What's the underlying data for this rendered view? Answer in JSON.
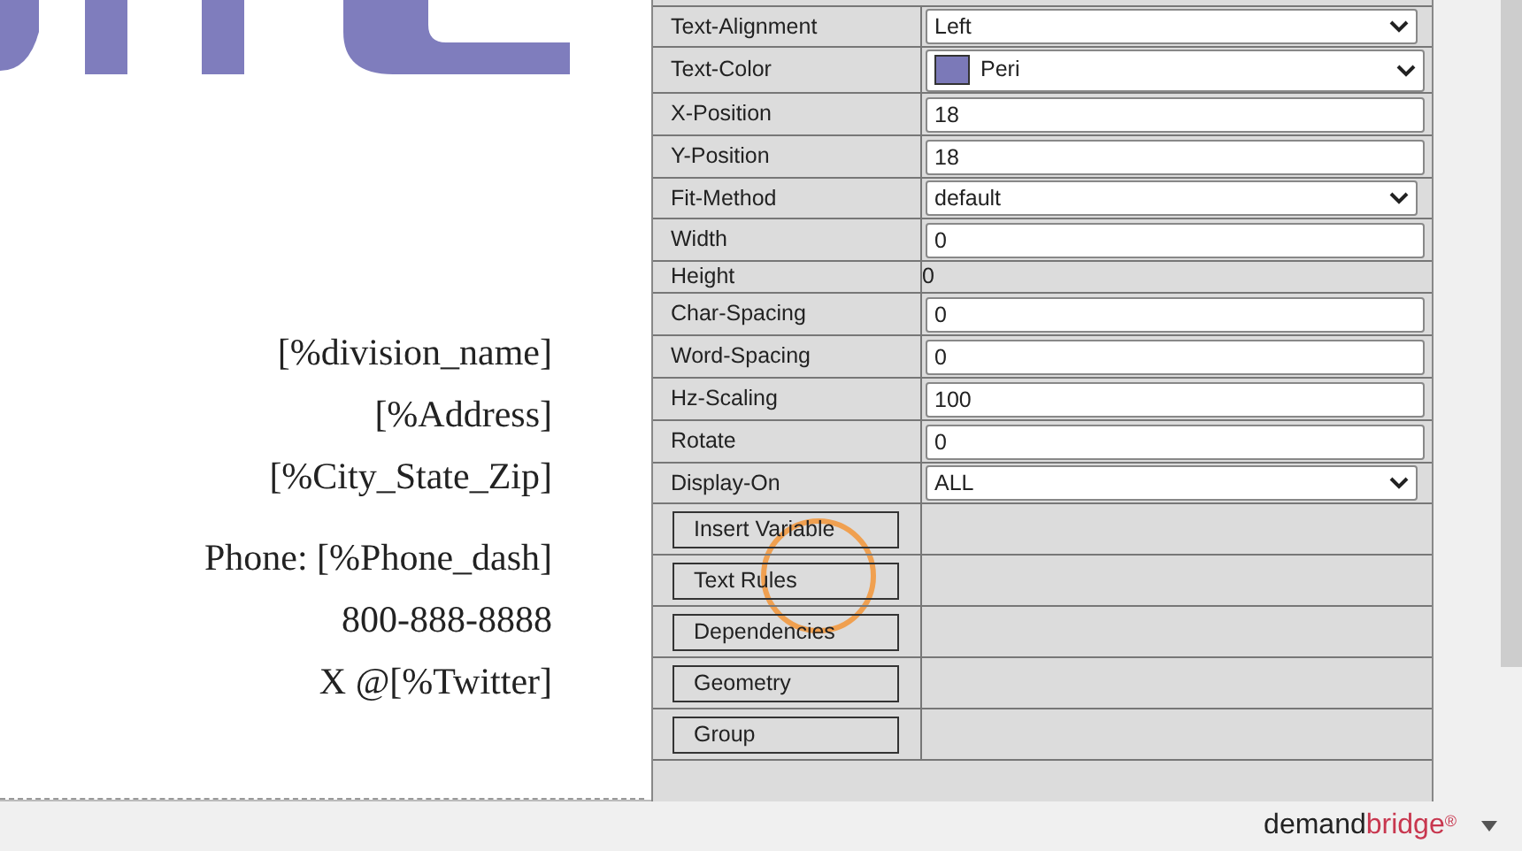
{
  "canvas": {
    "blocks": [
      [
        "[%division_name]",
        "[%Address]",
        "[%City_State_Zip]"
      ],
      [
        "Phone: [%Phone_dash]",
        "800-888-8888",
        "X @[%Twitter]"
      ]
    ]
  },
  "properties": [
    {
      "label": "Text-Alignment",
      "kind": "select",
      "value": "Left"
    },
    {
      "label": "Text-Color",
      "kind": "color-select",
      "value": "Peri",
      "color": "#7b79b8"
    },
    {
      "label": "X-Position",
      "kind": "input",
      "value": "18"
    },
    {
      "label": "Y-Position",
      "kind": "input",
      "value": "18"
    },
    {
      "label": "Fit-Method",
      "kind": "select",
      "value": "default"
    },
    {
      "label": "Width",
      "kind": "input",
      "value": "0"
    },
    {
      "label": "Height",
      "kind": "text",
      "value": "0"
    },
    {
      "label": "Char-Spacing",
      "kind": "input",
      "value": "0"
    },
    {
      "label": "Word-Spacing",
      "kind": "input",
      "value": "0"
    },
    {
      "label": "Hz-Scaling",
      "kind": "input",
      "value": "100"
    },
    {
      "label": "Rotate",
      "kind": "input",
      "value": "0"
    },
    {
      "label": "Display-On",
      "kind": "select",
      "value": "ALL"
    }
  ],
  "buttons": [
    "Insert Variable",
    "Text Rules",
    "Dependencies",
    "Geometry",
    "Group"
  ],
  "brand": {
    "first": "demand",
    "second": "bridge",
    "mark": "®"
  }
}
